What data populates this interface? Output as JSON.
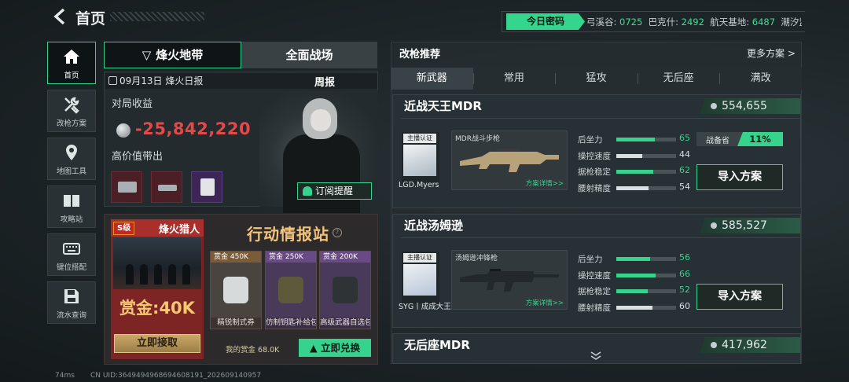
{
  "header": {
    "title": "首页"
  },
  "top_bar": {
    "password_button": "今日密码",
    "codes": [
      {
        "map": "弓溪谷:",
        "code": "0725"
      },
      {
        "map": "巴克什:",
        "code": "2492"
      },
      {
        "map": "航天基地:",
        "code": "6487"
      },
      {
        "map": "潮汐监狱:",
        "code": ""
      }
    ]
  },
  "nav": [
    {
      "label": "首页",
      "icon": "home-icon"
    },
    {
      "label": "改枪方案",
      "icon": "tools-icon"
    },
    {
      "label": "地图工具",
      "icon": "map-pin-icon"
    },
    {
      "label": "攻略站",
      "icon": "book-icon"
    },
    {
      "label": "键位搭配",
      "icon": "keyboard-icon"
    },
    {
      "label": "流水查询",
      "icon": "save-icon"
    }
  ],
  "mode_tabs": {
    "active": "烽火地带",
    "other": "全面战场"
  },
  "daily": {
    "date": "09月13日 烽火日报",
    "weekly": "周报",
    "income_label": "对局收益",
    "income_value": "-25,842,220",
    "high_value_label": "高价值带出",
    "subscribe_button": "订阅提醒"
  },
  "hunter": {
    "grade": "S级",
    "title": "烽火猎人",
    "bounty": "赏金:40K",
    "claim_button": "立即接取"
  },
  "intel": {
    "title": "行动情报站",
    "help": "?",
    "cards": [
      {
        "price": "赏金 450K",
        "name": "精锐制式券"
      },
      {
        "price": "赏金 250K",
        "name": "仿制钥匙补给包"
      },
      {
        "price": "赏金 200K",
        "name": "高级武器自选包"
      }
    ],
    "my_bounty": "我的赏金 68.0K",
    "exchange_button": "立即兑换"
  },
  "footer": {
    "ping": "74ms",
    "uid": "CN UID:3649494968694608191_202609140957"
  },
  "recommend": {
    "title": "改枪推荐",
    "more": "更多方案 >",
    "tabs": [
      "新武器",
      "常用",
      "猛攻",
      "无后座",
      "满改"
    ],
    "active_tab": "新武器",
    "stat_labels": [
      "后坐力",
      "操控速度",
      "据枪稳定",
      "腰射精度"
    ],
    "builds": [
      {
        "name": "近战天王MDR",
        "score": "554,655",
        "author_tag": "主播认证",
        "author": "LGD.Myers",
        "weapon": "MDR战斗步枪",
        "detail": "方案详情>>",
        "stats": [
          {
            "value": 65,
            "hi": true
          },
          {
            "value": 44,
            "hi": false
          },
          {
            "value": 62,
            "hi": true
          },
          {
            "value": 54,
            "hi": false
          }
        ],
        "prep_label": "战备省",
        "prep_value": "11%",
        "import_button": "导入方案"
      },
      {
        "name": "近战汤姆逊",
        "score": "585,527",
        "author_tag": "主播认证",
        "author": "SYG丨成成大王",
        "weapon": "汤姆逊冲锋枪",
        "detail": "方案详情>>",
        "stats": [
          {
            "value": 56,
            "hi": true
          },
          {
            "value": 66,
            "hi": true
          },
          {
            "value": 52,
            "hi": true
          },
          {
            "value": 60,
            "hi": false
          }
        ],
        "import_button": "导入方案"
      },
      {
        "name": "无后座MDR",
        "score": "417,962"
      }
    ]
  },
  "colors": {
    "accent": "#36d38d",
    "loss": "#e54848",
    "gold": "#f3c37b"
  }
}
